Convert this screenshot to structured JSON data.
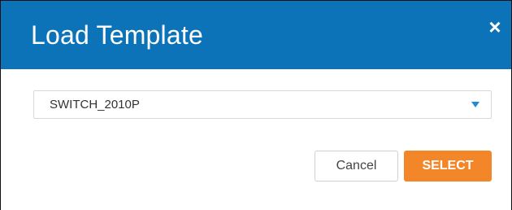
{
  "dialog": {
    "title": "Load Template",
    "close_glyph": "×",
    "close_icon": "close-icon"
  },
  "template_select": {
    "selected_value": "SWITCH_2010P",
    "arrow_icon": "caret-down-icon"
  },
  "actions": {
    "cancel_label": "Cancel",
    "select_label": "SELECT"
  },
  "colors": {
    "header_bg": "#0d73b8",
    "primary_button": "#f4862a",
    "dropdown_arrow": "#1f8ad6"
  }
}
